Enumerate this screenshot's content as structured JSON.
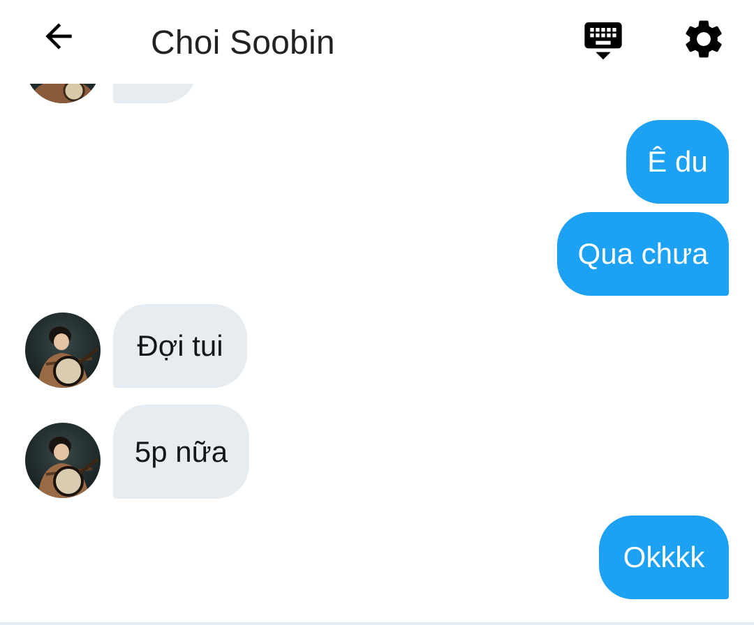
{
  "header": {
    "title": "Choi Soobin",
    "back_icon": "arrow-left-icon",
    "keyboard_icon": "keyboard-hide-icon",
    "settings_icon": "gear-icon"
  },
  "colors": {
    "outgoing_bubble": "#1da1f2",
    "incoming_bubble": "#e6ecf0",
    "background": "#ffffff"
  },
  "messages": [
    {
      "direction": "incoming",
      "text": ""
    },
    {
      "direction": "outgoing",
      "text": "Ê du"
    },
    {
      "direction": "outgoing",
      "text": "Qua chưa"
    },
    {
      "direction": "incoming",
      "text": "Đợi tui"
    },
    {
      "direction": "incoming",
      "text": "5p nữa"
    },
    {
      "direction": "outgoing",
      "text": "Okkkk"
    }
  ]
}
